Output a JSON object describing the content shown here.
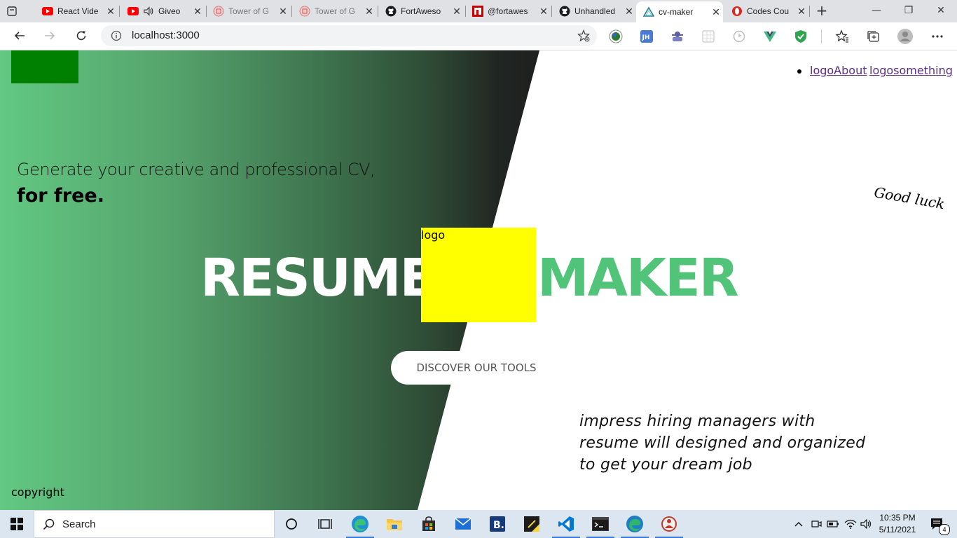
{
  "browser": {
    "tabs": [
      {
        "title": "React Vide",
        "icon": "youtube-icon"
      },
      {
        "title": "Giveo",
        "icon": "youtube-icon",
        "audio": true
      },
      {
        "title": "Tower of G",
        "icon": "tower-icon"
      },
      {
        "title": "Tower of G",
        "icon": "tower-icon"
      },
      {
        "title": "FortAweso",
        "icon": "github-icon"
      },
      {
        "title": "@fortawes",
        "icon": "npm-icon"
      },
      {
        "title": "Unhandled",
        "icon": "github-icon"
      },
      {
        "title": "cv-maker",
        "icon": "vite-icon",
        "active": true
      },
      {
        "title": "Codes Cou",
        "icon": "opera-icon"
      }
    ],
    "url": "localhost:3000"
  },
  "page": {
    "nav": {
      "about_label": "logoAbout",
      "something_label": "logosomething"
    },
    "tagline_line1": "Generate your creative and professional CV,",
    "tagline_line2": "for free.",
    "good_luck": "Good luck",
    "title_left": "RESUME",
    "title_right": "MAKER",
    "logo_alt": "logo",
    "discover_button": "DISCOVER OUR TOOLS",
    "impress_text": "impress hiring managers with resume will designed and organized to get your dream job",
    "copyright": "copyright",
    "colors": {
      "logo_box": "#008000",
      "maker_green": "#52c47a",
      "yellow_logo": "#ffff00",
      "link_visited": "#5b2a86"
    }
  },
  "taskbar": {
    "search_placeholder": "Search",
    "time": "10:35 PM",
    "date": "5/11/2021",
    "notifications": "4"
  }
}
